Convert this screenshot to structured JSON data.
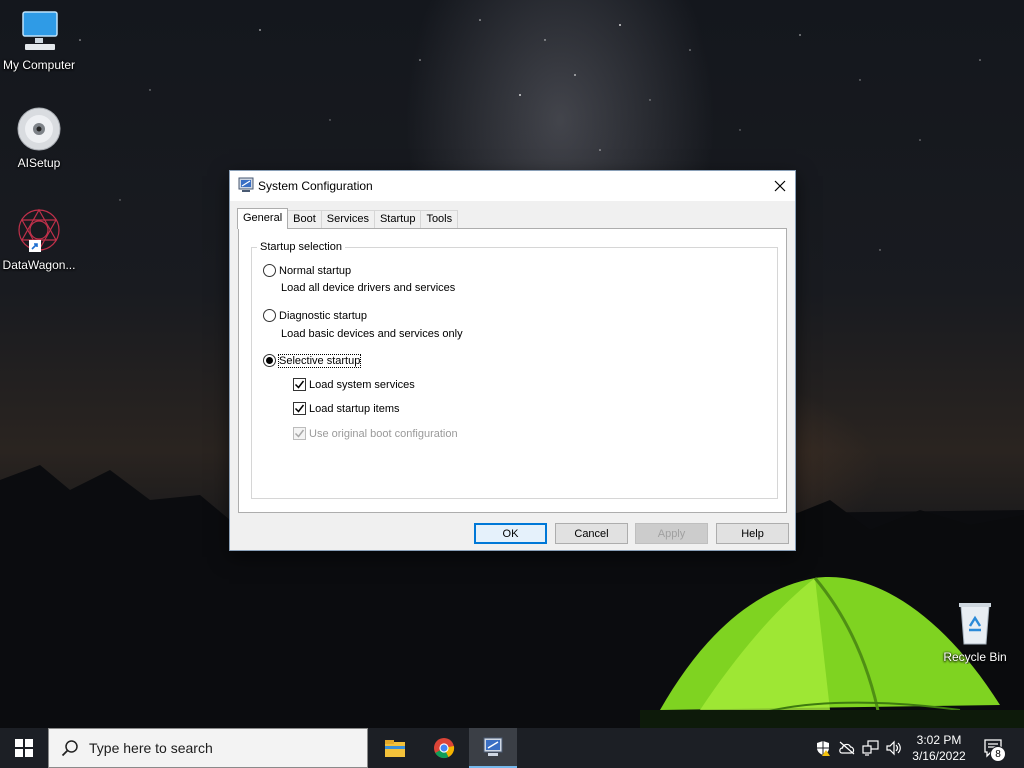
{
  "desktop": {
    "icons": [
      {
        "label": "My Computer",
        "icon": "monitor-icon"
      },
      {
        "label": "AISetup",
        "icon": "cd-icon"
      },
      {
        "label": "DataWagon...",
        "icon": "datawagon-shortcut-icon"
      },
      {
        "label": "Recycle Bin",
        "icon": "recycle-bin-icon"
      }
    ]
  },
  "dialog": {
    "title": "System Configuration",
    "tabs": [
      "General",
      "Boot",
      "Services",
      "Startup",
      "Tools"
    ],
    "active_tab": "General",
    "group_title": "Startup selection",
    "options": [
      {
        "label": "Normal startup",
        "description": "Load all device drivers and services",
        "selected": false
      },
      {
        "label": "Diagnostic startup",
        "description": "Load basic devices and services only",
        "selected": false
      },
      {
        "label": "Selective startup",
        "selected": true
      }
    ],
    "checkboxes": [
      {
        "label": "Load system services",
        "checked": true,
        "enabled": true
      },
      {
        "label": "Load startup items",
        "checked": true,
        "enabled": true
      },
      {
        "label": "Use original boot configuration",
        "checked": true,
        "enabled": false
      }
    ],
    "buttons": {
      "ok": "OK",
      "cancel": "Cancel",
      "apply": "Apply",
      "help": "Help"
    }
  },
  "taskbar": {
    "search_placeholder": "Type here to search",
    "pinned": [
      "file-explorer-icon",
      "chrome-icon",
      "system-configuration-icon"
    ],
    "clock": {
      "time": "3:02 PM",
      "date": "3/16/2022"
    },
    "notification_count": "8"
  },
  "colors": {
    "accent": "#0078d7",
    "taskbar": "#1c1f25",
    "dialog_bg": "#f0f0f0"
  }
}
